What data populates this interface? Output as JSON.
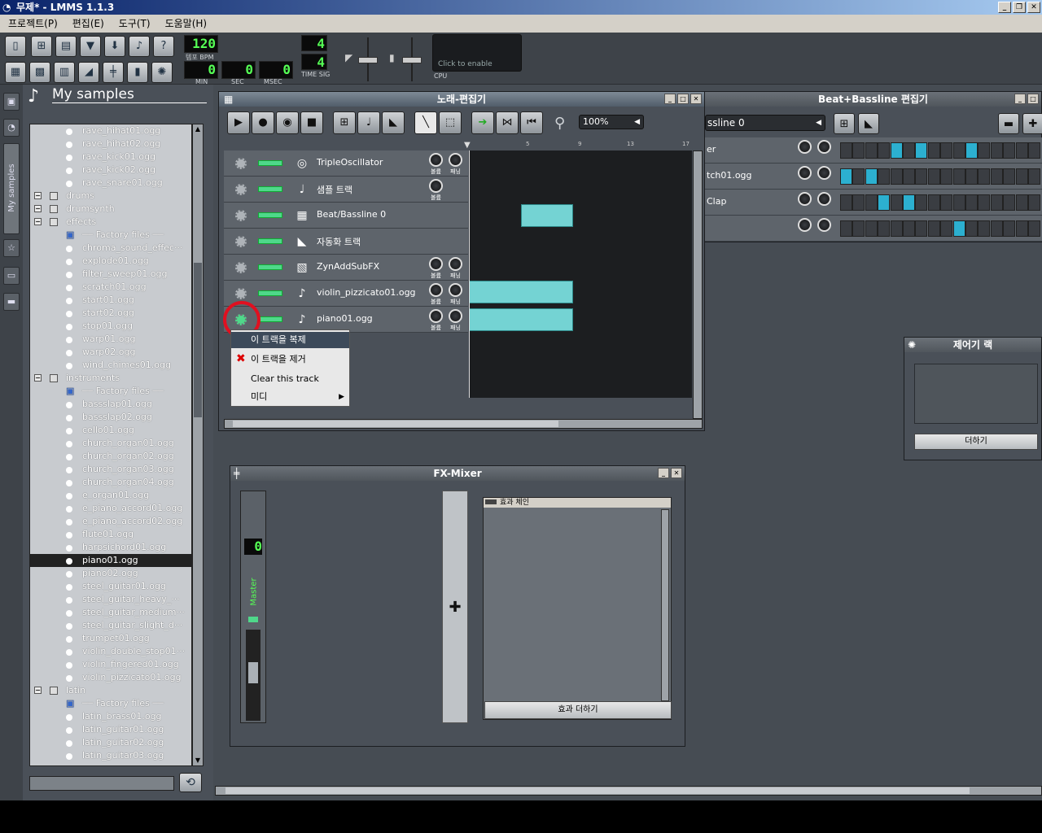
{
  "window": {
    "title": "무제* - LMMS 1.1.3"
  },
  "menu": [
    "프로젝트(P)",
    "편집(E)",
    "도구(T)",
    "도움말(H)"
  ],
  "toolbar": {
    "tempo_value": "120",
    "tempo_label": "템포 BPM",
    "min_value": "0",
    "min_label": "MIN",
    "sec_value": "0",
    "sec_label": "SEC",
    "msec_value": "0",
    "msec_label": "MSEC",
    "timesig_num": "4",
    "timesig_den": "4",
    "timesig_label": "TIME SIG",
    "cpu_text": "Click to enable",
    "cpu_label": "CPU"
  },
  "browser": {
    "title": "My samples",
    "tab_label": "My samples",
    "items": [
      {
        "label": "rave_hihat01.ogg",
        "kind": "file",
        "level": 2
      },
      {
        "label": "rave_hihat02.ogg",
        "kind": "file",
        "level": 2
      },
      {
        "label": "rave_kick01.ogg",
        "kind": "file",
        "level": 2
      },
      {
        "label": "rave_kick02.ogg",
        "kind": "file",
        "level": 2
      },
      {
        "label": "rave_snare01.ogg",
        "kind": "file",
        "level": 2
      },
      {
        "label": "drums",
        "kind": "folder",
        "level": 1
      },
      {
        "label": "drumsynth",
        "kind": "folder",
        "level": 1
      },
      {
        "label": "effects",
        "kind": "folder",
        "level": 1
      },
      {
        "label": "── Factory files ──",
        "kind": "factory",
        "level": 2
      },
      {
        "label": "chroma_sound_effec···",
        "kind": "file",
        "level": 2
      },
      {
        "label": "explode01.ogg",
        "kind": "file",
        "level": 2
      },
      {
        "label": "filter_sweep01.ogg",
        "kind": "file",
        "level": 2
      },
      {
        "label": "scratch01.ogg",
        "kind": "file",
        "level": 2
      },
      {
        "label": "start01.ogg",
        "kind": "file",
        "level": 2
      },
      {
        "label": "start02.ogg",
        "kind": "file",
        "level": 2
      },
      {
        "label": "stop01.ogg",
        "kind": "file",
        "level": 2
      },
      {
        "label": "warp01.ogg",
        "kind": "file",
        "level": 2
      },
      {
        "label": "warp02.ogg",
        "kind": "file",
        "level": 2
      },
      {
        "label": "wind_chimes01.ogg",
        "kind": "file",
        "level": 2
      },
      {
        "label": "instruments",
        "kind": "folder",
        "level": 1
      },
      {
        "label": "── Factory files ──",
        "kind": "factory",
        "level": 2
      },
      {
        "label": "bassslap01.ogg",
        "kind": "file",
        "level": 2
      },
      {
        "label": "bassslap02.ogg",
        "kind": "file",
        "level": 2
      },
      {
        "label": "cello01.ogg",
        "kind": "file",
        "level": 2
      },
      {
        "label": "church_organ01.ogg",
        "kind": "file",
        "level": 2
      },
      {
        "label": "church_organ02.ogg",
        "kind": "file",
        "level": 2
      },
      {
        "label": "church_organ03.ogg",
        "kind": "file",
        "level": 2
      },
      {
        "label": "church_organ04.ogg",
        "kind": "file",
        "level": 2
      },
      {
        "label": "e_organ01.ogg",
        "kind": "file",
        "level": 2
      },
      {
        "label": "e_piano_accord01.ogg",
        "kind": "file",
        "level": 2
      },
      {
        "label": "e_piano_accord02.ogg",
        "kind": "file",
        "level": 2
      },
      {
        "label": "flute01.ogg",
        "kind": "file",
        "level": 2
      },
      {
        "label": "harpsichord01.ogg",
        "kind": "file",
        "level": 2
      },
      {
        "label": "piano01.ogg",
        "kind": "file",
        "level": 2,
        "selected": true
      },
      {
        "label": "piano02.ogg",
        "kind": "file",
        "level": 2
      },
      {
        "label": "steel_guitar01.ogg",
        "kind": "file",
        "level": 2
      },
      {
        "label": "steel_guitar_heavy_···",
        "kind": "file",
        "level": 2
      },
      {
        "label": "steel_guitar_medium···",
        "kind": "file",
        "level": 2
      },
      {
        "label": "steel_guitar_slight_d···",
        "kind": "file",
        "level": 2
      },
      {
        "label": "trumpet01.ogg",
        "kind": "file",
        "level": 2
      },
      {
        "label": "violin_double_stop01···",
        "kind": "file",
        "level": 2
      },
      {
        "label": "violin_fingered01.ogg",
        "kind": "file",
        "level": 2
      },
      {
        "label": "violin_pizzicato01.ogg",
        "kind": "file",
        "level": 2
      },
      {
        "label": "latin",
        "kind": "folder",
        "level": 1
      },
      {
        "label": "── Factory files ──",
        "kind": "factory",
        "level": 2
      },
      {
        "label": "latin_brass01.ogg",
        "kind": "file",
        "level": 2
      },
      {
        "label": "latin_guitar01.ogg",
        "kind": "file",
        "level": 2
      },
      {
        "label": "latin_guitar02.ogg",
        "kind": "file",
        "level": 2
      },
      {
        "label": "latin_guitar03.ogg",
        "kind": "file",
        "level": 2
      }
    ]
  },
  "song_editor": {
    "title": "노래-편집기",
    "zoom": "100%",
    "ruler_marks": [
      "5",
      "9",
      "13",
      "17"
    ],
    "tracks": [
      {
        "name": "TripleOscillator",
        "icon": "oscillator-icon",
        "knobs": 2
      },
      {
        "name": "샘플 트랙",
        "icon": "sample-track-icon",
        "knobs": 1
      },
      {
        "name": "Beat/Bassline 0",
        "icon": "beat-bassline-icon",
        "knobs": 0
      },
      {
        "name": "자동화 트랙",
        "icon": "automation-icon",
        "knobs": 0
      },
      {
        "name": "ZynAddSubFX",
        "icon": "zyn-icon",
        "knobs": 2
      },
      {
        "name": "violin_pizzicato01.ogg",
        "icon": "note-icon",
        "knobs": 2
      },
      {
        "name": "piano01.ogg",
        "icon": "note-icon",
        "knobs": 2
      }
    ],
    "knob_labels": [
      "볼륨",
      "패닝"
    ]
  },
  "context_menu": {
    "items": [
      "이 트랙을 복제",
      "이 트랙을 제거",
      "Clear this track",
      "미디"
    ]
  },
  "bb_editor": {
    "title": "Beat+Bassline 편집기",
    "select_value": "ssline 0",
    "rows": [
      {
        "name": "er",
        "on": [
          4,
          6,
          10
        ]
      },
      {
        "name": "tch01.ogg",
        "on": [
          0,
          2
        ]
      },
      {
        "name": "Clap",
        "on": [
          3,
          5
        ]
      },
      {
        "name": "",
        "on": [
          9
        ]
      }
    ]
  },
  "controller_rack": {
    "title": "제어기 랙",
    "add_label": "더하기"
  },
  "fx_mixer": {
    "title": "FX-Mixer",
    "master_label": "Master",
    "channel_number": "0",
    "effect_chain_label": "효과 체인",
    "add_effect_label": "효과 더하기"
  },
  "colors": {
    "accent": "#74d3d3",
    "lcd": "#55ff55",
    "pattern_on": "#2cb0d0",
    "highlight_circle": "#e01020"
  }
}
